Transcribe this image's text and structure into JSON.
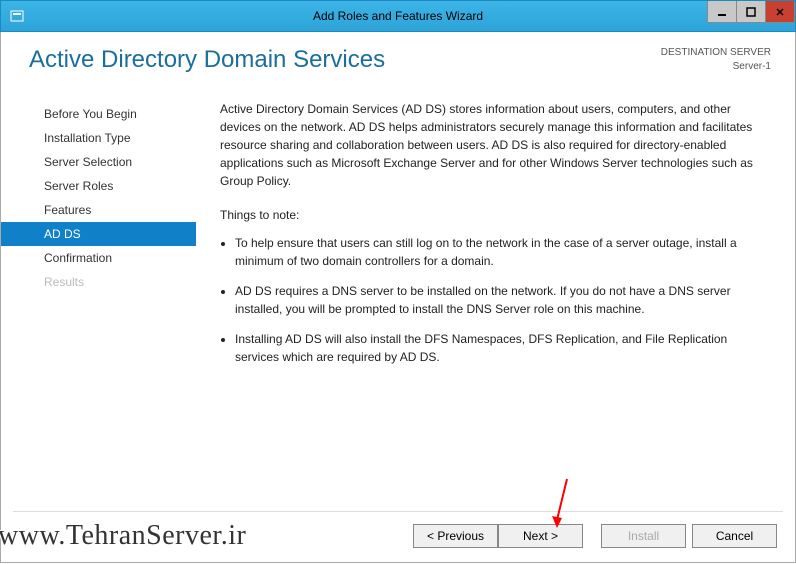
{
  "window": {
    "title": "Add Roles and Features Wizard"
  },
  "header": {
    "heading": "Active Directory Domain Services",
    "dest_label": "DESTINATION SERVER",
    "dest_server": "Server-1"
  },
  "sidebar": {
    "items": [
      {
        "label": "Before You Begin",
        "state": "normal"
      },
      {
        "label": "Installation Type",
        "state": "normal"
      },
      {
        "label": "Server Selection",
        "state": "normal"
      },
      {
        "label": "Server Roles",
        "state": "normal"
      },
      {
        "label": "Features",
        "state": "normal"
      },
      {
        "label": "AD DS",
        "state": "active"
      },
      {
        "label": "Confirmation",
        "state": "normal"
      },
      {
        "label": "Results",
        "state": "disabled"
      }
    ]
  },
  "content": {
    "intro": "Active Directory Domain Services (AD DS) stores information about users, computers, and other devices on the network.  AD DS helps administrators securely manage this information and facilitates resource sharing and collaboration between users.  AD DS is also required for directory-enabled applications such as Microsoft Exchange Server and for other Windows Server technologies such as Group Policy.",
    "notes_heading": "Things to note:",
    "notes": [
      "To help ensure that users can still log on to the network in the case of a server outage, install a minimum of two domain controllers for a domain.",
      "AD DS requires a DNS server to be installed on the network.  If you do not have a DNS server installed, you will be prompted to install the DNS Server role on this machine.",
      "Installing AD DS will also install the DFS Namespaces, DFS Replication, and File Replication services which are required by AD DS."
    ]
  },
  "buttons": {
    "previous": "< Previous",
    "next": "Next >",
    "install": "Install",
    "cancel": "Cancel"
  },
  "watermark": "www.TehranServer.ir",
  "colors": {
    "titlebar": "#2da4d8",
    "heading": "#1b6e9c",
    "active_nav": "#1080c8",
    "close_btn": "#c84030",
    "arrow": "#ff0000"
  }
}
